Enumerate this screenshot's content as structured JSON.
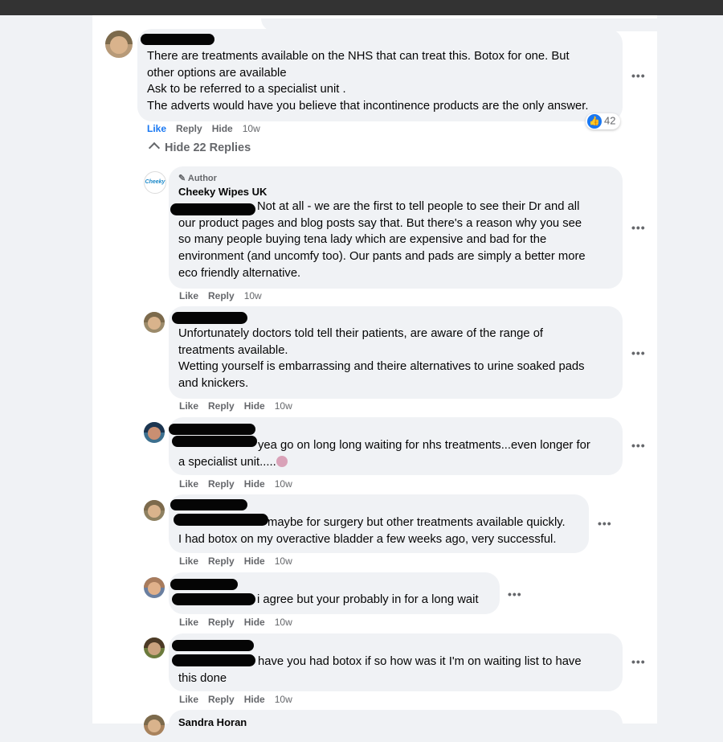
{
  "main_comment": {
    "text": [
      "There are treatments available on the NHS that can treat this. Botox for one. But",
      "other options are available",
      "Ask to be referred to a specialist unit .",
      "The adverts would have you believe that incontinence products are the only answer."
    ],
    "actions": {
      "like": "Like",
      "reply": "Reply",
      "hide": "Hide",
      "time": "10w"
    },
    "reactions_count": "42",
    "more_label": "•••"
  },
  "hide_replies_label": "Hide 22 Replies",
  "replies": [
    {
      "author_badge": "Author",
      "name": "Cheeky Wipes UK",
      "logo_text": "Cheeky",
      "text": [
        "Not at all - we are the first to tell people to see their Dr and all",
        "our product pages and blog posts say that. But there's a reason why you see",
        "so many people buying tena lady which are expensive and bad for the",
        "environment (and uncomfy too). Our pants and pads are simply a better more",
        "eco friendly alternative."
      ],
      "actions": {
        "like": "Like",
        "reply": "Reply",
        "time": "10w"
      }
    },
    {
      "text": [
        "Unfortunately doctors told tell their patients, are aware of the range of",
        "treatments available.",
        "Wetting yourself is embarrassing and theire alternatives to urine soaked pads",
        "and knickers."
      ],
      "actions": {
        "like": "Like",
        "reply": "Reply",
        "hide": "Hide",
        "time": "10w"
      }
    },
    {
      "text": [
        "yea go on long long waiting for nhs treatments...even longer for",
        "a specialist unit....."
      ],
      "actions": {
        "like": "Like",
        "reply": "Reply",
        "hide": "Hide",
        "time": "10w"
      }
    },
    {
      "text": [
        "maybe for surgery but other treatments available quickly.",
        "I had botox on my overactive bladder a few weeks ago, very successful."
      ],
      "actions": {
        "like": "Like",
        "reply": "Reply",
        "hide": "Hide",
        "time": "10w"
      }
    },
    {
      "text": [
        "i agree but your probably in for a long wait"
      ],
      "actions": {
        "like": "Like",
        "reply": "Reply",
        "hide": "Hide",
        "time": "10w"
      }
    },
    {
      "text": [
        "have you had botox if so how was it I'm on waiting list to have",
        "this done"
      ],
      "actions": {
        "like": "Like",
        "reply": "Reply",
        "hide": "Hide",
        "time": "10w"
      }
    },
    {
      "name": "Sandra Horan"
    }
  ]
}
